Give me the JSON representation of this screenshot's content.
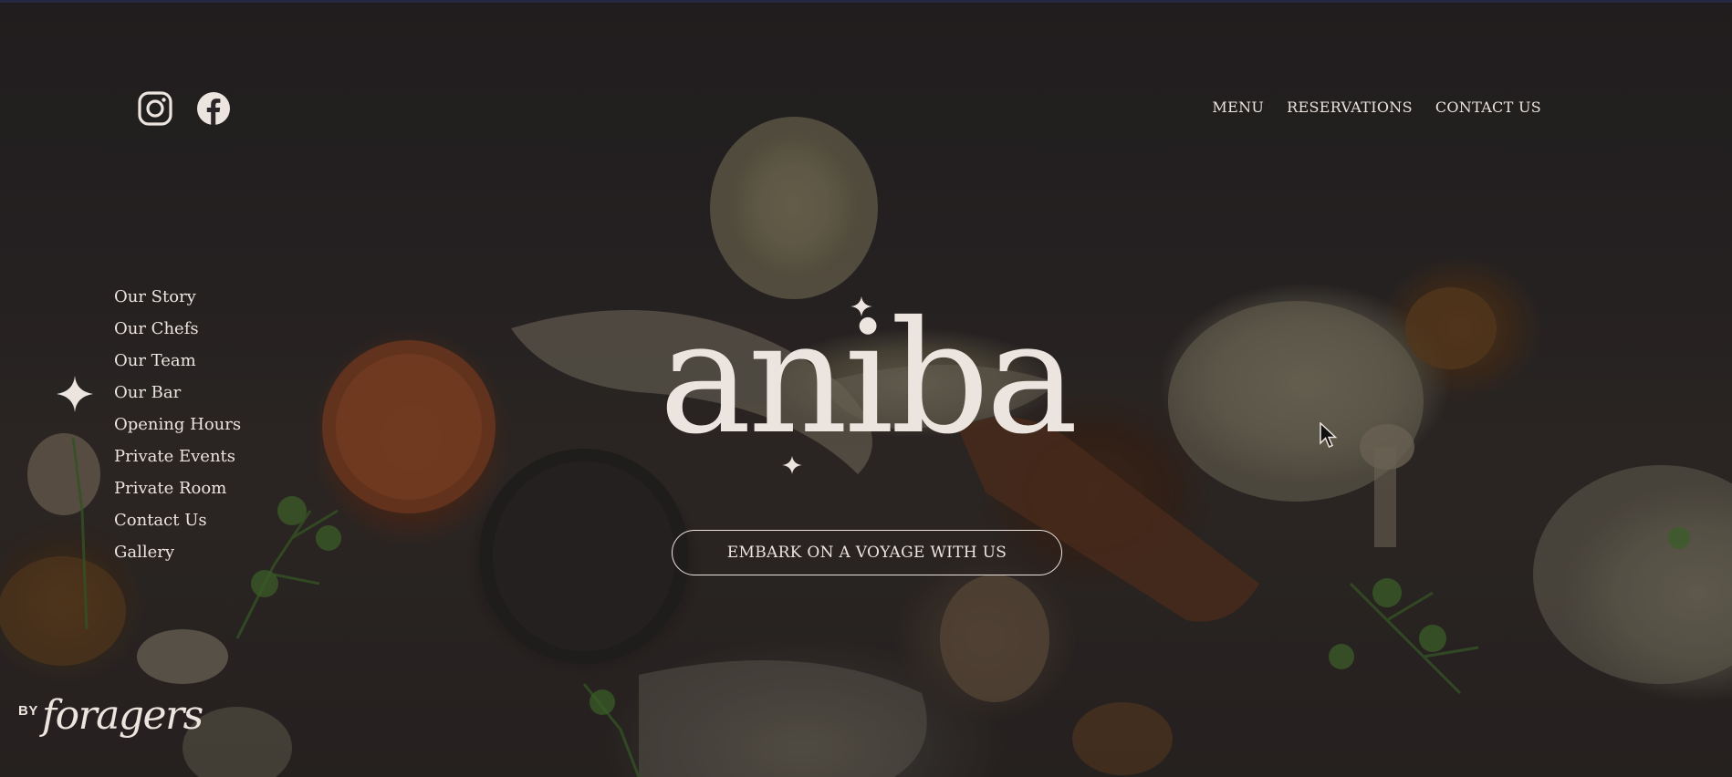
{
  "brand": {
    "logo_text": "aniba",
    "by_label": "BY",
    "parent_brand": "foragers"
  },
  "social": {
    "instagram_icon": "instagram-icon",
    "facebook_icon": "facebook-icon"
  },
  "topnav": {
    "items": [
      {
        "label": "MENU"
      },
      {
        "label": "RESERVATIONS"
      },
      {
        "label": "CONTACT US"
      }
    ]
  },
  "sidenav": {
    "active_index": 3,
    "items": [
      {
        "label": "Our Story"
      },
      {
        "label": "Our Chefs"
      },
      {
        "label": "Our Team"
      },
      {
        "label": "Our Bar"
      },
      {
        "label": "Opening Hours"
      },
      {
        "label": "Private Events"
      },
      {
        "label": "Private Room"
      },
      {
        "label": "Contact Us"
      },
      {
        "label": "Gallery"
      }
    ]
  },
  "hero": {
    "cta_label": "EMBARK ON A VOYAGE WITH US"
  },
  "colors": {
    "text": "#ece4de",
    "background": "#2a2627",
    "top_border": "#2d3052"
  }
}
